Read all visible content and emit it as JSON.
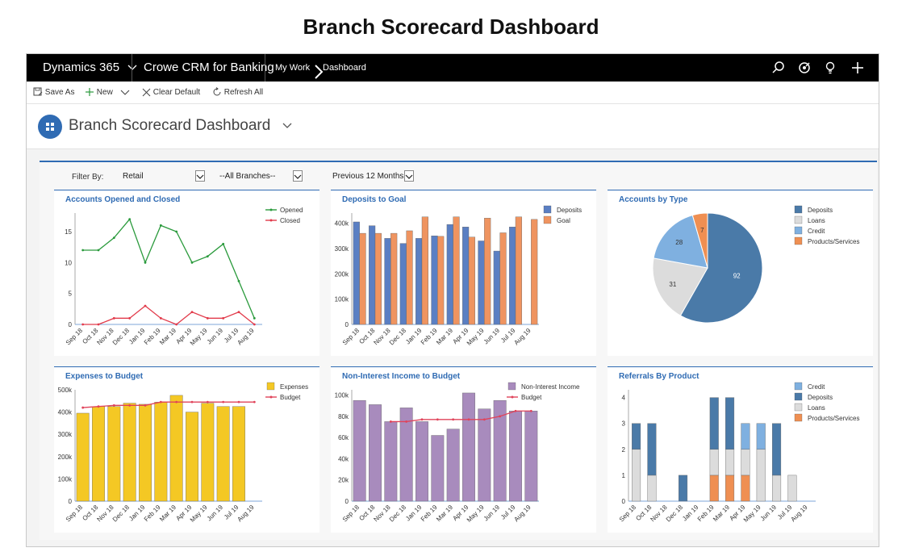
{
  "page_heading": "Branch Scorecard Dashboard",
  "nav": {
    "app_name": "Dynamics 365",
    "module_name": "Crowe CRM for Banking",
    "crumb_1": "My Work",
    "crumb_2": "Dashboard",
    "icons": [
      "search-icon",
      "target-icon",
      "lightbulb-icon",
      "plus-icon"
    ]
  },
  "commands": {
    "save_as": "Save As",
    "new": "New",
    "clear_default": "Clear Default",
    "refresh_all": "Refresh All"
  },
  "title": "Branch Scorecard Dashboard",
  "filters": {
    "label": "Filter By:",
    "segment": "Retail",
    "branches": "--All Branches--",
    "period": "Previous 12 Months"
  },
  "colors": {
    "accent": "#2f6bb3",
    "navbar": "#000000",
    "opened": "#2a9a3c",
    "closed": "#e23b4b",
    "deposits": "#5a7fc3",
    "goal": "#ef9460",
    "expenses": "#f4c824",
    "noninterest": "#a88bbd",
    "budget": "#e0435a",
    "pie_deposits": "#4a7aa8",
    "pie_loans": "#dcdcdc",
    "pie_credit": "#7fb0e0",
    "pie_products": "#ef8f52"
  },
  "months": [
    "Sep 18",
    "Oct 18",
    "Nov 18",
    "Dec 18",
    "Jan 19",
    "Feb 19",
    "Mar 19",
    "Apr 19",
    "May 19",
    "Jun 19",
    "Jul 19",
    "Aug 19"
  ],
  "chart_data": [
    {
      "id": "accounts-opened-closed",
      "type": "line",
      "title": "Accounts Opened and Closed",
      "categories": [
        "Sep 18",
        "Oct 18",
        "Nov 18",
        "Dec 18",
        "Jan 19",
        "Feb 19",
        "Mar 19",
        "Apr 19",
        "May 19",
        "Jun 19",
        "Jul 19",
        "Aug 19"
      ],
      "series": [
        {
          "name": "Opened",
          "values": [
            12,
            12,
            14,
            17,
            10,
            16,
            15,
            10,
            11,
            13,
            7,
            1
          ]
        },
        {
          "name": "Closed",
          "values": [
            0,
            0,
            1,
            1,
            3,
            1,
            0,
            2,
            1,
            1,
            2,
            0
          ]
        }
      ],
      "ylim": [
        0,
        18
      ],
      "yticks": [
        "0",
        "5",
        "10",
        "15"
      ],
      "legend": "top-right"
    },
    {
      "id": "deposits-to-goal",
      "type": "bar",
      "title": "Deposits to Goal",
      "categories": [
        "Sep 18",
        "Oct 18",
        "Nov 18",
        "Dec 18",
        "Jan 19",
        "Feb 19",
        "Mar 19",
        "Apr 19",
        "May 19",
        "Jun 19",
        "Jul 19",
        "Aug 19"
      ],
      "series": [
        {
          "name": "Deposits",
          "values": [
            405000,
            390000,
            340000,
            320000,
            340000,
            350000,
            395000,
            385000,
            330000,
            290000,
            385000,
            0
          ]
        },
        {
          "name": "Goal",
          "values": [
            360000,
            360000,
            360000,
            370000,
            425000,
            348000,
            425000,
            345000,
            420000,
            362000,
            425000,
            415000
          ]
        }
      ],
      "ylim": [
        0,
        440000
      ],
      "yticks": [
        "0",
        "100k",
        "200k",
        "300k",
        "400k"
      ],
      "legend": "top-right"
    },
    {
      "id": "accounts-by-type",
      "type": "pie",
      "title": "Accounts by Type",
      "slices": [
        {
          "name": "Deposits",
          "value": 92
        },
        {
          "name": "Loans",
          "value": 31
        },
        {
          "name": "Credit",
          "value": 28
        },
        {
          "name": "Products/Services",
          "value": 7
        }
      ],
      "legend": "top-right"
    },
    {
      "id": "expenses-to-budget",
      "type": "bar",
      "title": "Expenses to Budget",
      "categories": [
        "Sep 18",
        "Oct 18",
        "Nov 18",
        "Dec 18",
        "Jan 19",
        "Feb 19",
        "Mar 19",
        "Apr 19",
        "May 19",
        "Jun 19",
        "Jul 19",
        "Aug 19"
      ],
      "series": [
        {
          "name": "Expenses",
          "values": [
            395000,
            425000,
            425000,
            440000,
            435000,
            445000,
            475000,
            400000,
            440000,
            425000,
            425000,
            0
          ]
        },
        {
          "name": "Budget",
          "values": [
            420000,
            425000,
            430000,
            430000,
            430000,
            445000,
            445000,
            445000,
            445000,
            445000,
            445000,
            445000
          ]
        }
      ],
      "ylim": [
        0,
        500000
      ],
      "yticks": [
        "0",
        "100k",
        "200k",
        "300k",
        "400k",
        "500k"
      ],
      "legend": "top-right"
    },
    {
      "id": "non-interest-income",
      "type": "bar",
      "title": "Non-Interest Income to Budget",
      "categories": [
        "Sep 18",
        "Oct 18",
        "Nov 18",
        "Dec 18",
        "Jan 19",
        "Feb 19",
        "Mar 19",
        "Apr 19",
        "May 19",
        "Jun 19",
        "Jul 19",
        "Aug 19"
      ],
      "series": [
        {
          "name": "Non-Interest Income",
          "values": [
            95000,
            91000,
            75000,
            88000,
            75000,
            62000,
            68000,
            102000,
            87000,
            95000,
            85000,
            85000
          ]
        },
        {
          "name": "Budget",
          "values": [
            null,
            null,
            75000,
            75000,
            77000,
            77000,
            77000,
            77000,
            77000,
            80000,
            85000,
            85000
          ]
        }
      ],
      "ylim": [
        0,
        105000
      ],
      "yticks": [
        "0",
        "20k",
        "40k",
        "60k",
        "80k",
        "100k"
      ],
      "legend": "top-right"
    },
    {
      "id": "referrals-by-product",
      "type": "bar",
      "stacked": true,
      "title": "Referrals By Product",
      "categories": [
        "Sep 18",
        "Oct 18",
        "Nov 18",
        "Dec 18",
        "Jan 19",
        "Feb 19",
        "Mar 19",
        "Apr 19",
        "May 19",
        "Jun 19",
        "Jul 19",
        "Aug 19"
      ],
      "series": [
        {
          "name": "Products/Services",
          "values": [
            0,
            0,
            0,
            0,
            0,
            1,
            1,
            1,
            0,
            0,
            0,
            0
          ]
        },
        {
          "name": "Loans",
          "values": [
            2,
            1,
            0,
            0,
            0,
            1,
            1,
            1,
            2,
            1,
            1,
            0
          ]
        },
        {
          "name": "Deposits",
          "values": [
            1,
            2,
            0,
            1,
            0,
            2,
            2,
            0,
            0,
            2,
            0,
            0
          ]
        },
        {
          "name": "Credit",
          "values": [
            0,
            0,
            0,
            0,
            0,
            0,
            0,
            1,
            1,
            0,
            0,
            0
          ]
        }
      ],
      "legend_order": [
        "Credit",
        "Deposits",
        "Loans",
        "Products/Services"
      ],
      "ylim": [
        0,
        4.3
      ],
      "yticks": [
        "0",
        "1",
        "2",
        "3",
        "4"
      ],
      "legend": "top-right"
    }
  ]
}
